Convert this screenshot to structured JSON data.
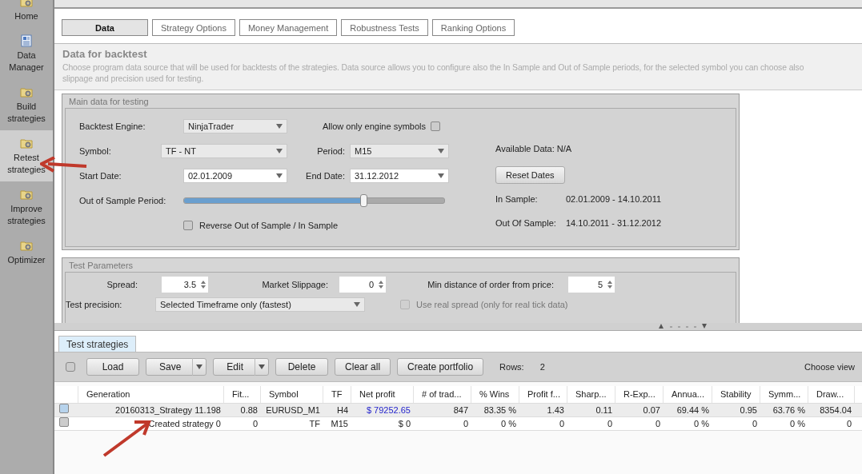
{
  "sidebar": {
    "items": [
      {
        "label": "Home",
        "selected": false
      },
      {
        "label": "Data Manager",
        "selected": false
      },
      {
        "label": "Build strategies",
        "selected": false
      },
      {
        "label": "Retest strategies",
        "selected": true
      },
      {
        "label": "Improve strategies",
        "selected": false
      },
      {
        "label": "Optimizer",
        "selected": false
      }
    ]
  },
  "tabs": [
    {
      "label": "Data",
      "selected": true
    },
    {
      "label": "Strategy Options",
      "selected": false
    },
    {
      "label": "Money Management",
      "selected": false
    },
    {
      "label": "Robustness Tests",
      "selected": false
    },
    {
      "label": "Ranking Options",
      "selected": false
    }
  ],
  "header": {
    "title": "Data for backtest",
    "description": "Choose program data source that will be used for backtests of the strategies. Data source allows you to configure also the In Sample and Out of Sample periods, for the selected symbol you can choose also",
    "description_2": "slippage and precision used for testing."
  },
  "main_panel": {
    "title": "Main data for testing",
    "backtest_engine": {
      "label": "Backtest Engine:",
      "value": "NinjaTrader"
    },
    "allow_engine_symbols": {
      "label": "Allow only engine symbols",
      "checked": false
    },
    "symbol": {
      "label": "Symbol:",
      "value": "TF - NT"
    },
    "period": {
      "label": "Period:",
      "value": "M15"
    },
    "start_date": {
      "label": "Start Date:",
      "value": "02.01.2009"
    },
    "end_date": {
      "label": "End Date:",
      "value": "31.12.2012"
    },
    "oos_period": {
      "label": "Out of Sample Period:",
      "level": 0.69
    },
    "reverse": {
      "label": "Reverse Out of Sample / In Sample",
      "checked": false
    },
    "available_data": "Available Data: N/A",
    "reset_button": "Reset Dates",
    "in_sample": {
      "label": "In Sample:",
      "value": "02.01.2009 - 14.10.2011"
    },
    "out_of_sample": {
      "label": "Out Of Sample:",
      "value": "14.10.2011 - 31.12.2012"
    }
  },
  "test_parameters": {
    "title": "Test Parameters",
    "spread": {
      "label": "Spread:",
      "value": "3.5"
    },
    "slippage": {
      "label": "Market Slippage:",
      "value": "0"
    },
    "min_distance": {
      "label": "Min distance of order from price:",
      "value": "5"
    },
    "precision": {
      "label": "Test precision:",
      "value": "Selected Timeframe only (fastest)"
    },
    "real_spread": {
      "label": "Use real spread (only for real tick data)",
      "checked": false,
      "disabled": true
    }
  },
  "bottom_tabs": [
    {
      "label": "Test strategies",
      "selected": true
    }
  ],
  "toolbar": {
    "select_all_checked": false,
    "buttons": [
      {
        "label": "Load",
        "kind": "plain"
      },
      {
        "label": "Save",
        "kind": "split"
      },
      {
        "label": "Edit",
        "kind": "split"
      },
      {
        "label": "Delete",
        "kind": "plain"
      },
      {
        "label": "Clear all",
        "kind": "plain"
      },
      {
        "label": "Create portfolio",
        "kind": "plain"
      }
    ],
    "rows_label": "Rows:",
    "rows_value": "2",
    "choose_view": "Choose view"
  },
  "table": {
    "columns": [
      "Generation",
      "Fit...",
      "Symbol",
      "TF",
      "Net profit",
      "# of trad...",
      "% Wins",
      "Profit f...",
      "Sharp...",
      "R-Exp...",
      "Annua...",
      "Stability",
      "Symm...",
      "Draw..."
    ],
    "rows": [
      {
        "selected": true,
        "profit_positive": true,
        "cells": [
          "20160313_Strategy 11.198",
          "0.88",
          "EURUSD_M1",
          "H4",
          "$ 79252.65",
          "847",
          "83.35 %",
          "1.43",
          "0.11",
          "0.07",
          "69.44 %",
          "0.95",
          "63.76 %",
          "8354.04"
        ]
      },
      {
        "selected": false,
        "profit_positive": false,
        "cells": [
          "Created strategy 0",
          "0",
          "TF",
          "M15",
          "$ 0",
          "0",
          "0 %",
          "0",
          "0",
          "0",
          "0 %",
          "0",
          "0 %",
          "0"
        ]
      }
    ]
  }
}
